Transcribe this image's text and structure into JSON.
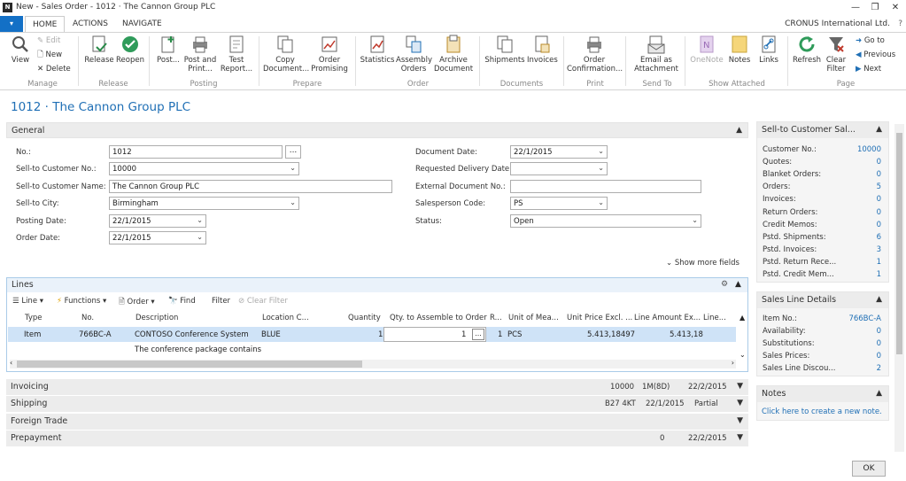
{
  "window": {
    "title": "New - Sales Order - 1012 · The Cannon Group PLC",
    "logo": "N",
    "company": "CRONUS International Ltd.",
    "help": "?"
  },
  "tabs": {
    "menu": "▾",
    "home": "HOME",
    "actions": "ACTIONS",
    "navigate": "NAVIGATE"
  },
  "ribbon": {
    "view": "View",
    "edit": "Edit",
    "new": "New",
    "delete": "Delete",
    "release": "Release",
    "reopen": "Reopen",
    "post": "Post...",
    "post_print_1": "Post and",
    "post_print_2": "Print...",
    "test_1": "Test",
    "test_2": "Report...",
    "copy_1": "Copy",
    "copy_2": "Document...",
    "promising_1": "Order",
    "promising_2": "Promising",
    "statistics": "Statistics",
    "assembly_1": "Assembly",
    "assembly_2": "Orders",
    "archive_1": "Archive",
    "archive_2": "Document",
    "shipments": "Shipments",
    "invoices": "Invoices",
    "order_conf_1": "Order",
    "order_conf_2": "Confirmation...",
    "email_1": "Email as",
    "email_2": "Attachment",
    "onenote": "OneNote",
    "notes": "Notes",
    "links": "Links",
    "refresh": "Refresh",
    "clear_1": "Clear",
    "clear_2": "Filter",
    "goto": "Go to",
    "previous": "Previous",
    "next": "Next",
    "groups": {
      "manage": "Manage",
      "release": "Release",
      "posting": "Posting",
      "prepare": "Prepare",
      "order": "Order",
      "documents": "Documents",
      "print": "Print",
      "send_to": "Send To",
      "show_attached": "Show Attached",
      "page": "Page"
    }
  },
  "page_title": "1012 · The Cannon Group PLC",
  "general": {
    "title": "General",
    "no_label": "No.:",
    "no_value": "1012",
    "cust_no_label": "Sell-to Customer No.:",
    "cust_no_value": "10000",
    "cust_name_label": "Sell-to Customer Name:",
    "cust_name_value": "The Cannon Group PLC",
    "city_label": "Sell-to City:",
    "city_value": "Birmingham",
    "posting_label": "Posting Date:",
    "posting_value": "22/1/2015",
    "order_label": "Order Date:",
    "order_value": "22/1/2015",
    "doc_date_label": "Document Date:",
    "doc_date_value": "22/1/2015",
    "req_del_label": "Requested Delivery Date:",
    "req_del_value": "",
    "ext_doc_label": "External Document No.:",
    "ext_doc_value": "",
    "salesperson_label": "Salesperson Code:",
    "salesperson_value": "PS",
    "status_label": "Status:",
    "status_value": "Open",
    "show_more": "Show more fields",
    "ellipsis": "..."
  },
  "lines": {
    "title": "Lines",
    "toolbar": {
      "line": "Line",
      "functions": "Functions",
      "order": "Order",
      "find": "Find",
      "filter": "Filter",
      "clear_filter": "Clear Filter"
    },
    "headers": [
      "Type",
      "No.",
      "Description",
      "Location C...",
      "Quantity",
      "Qty. to Assemble to Order",
      "R...",
      "Unit of Mea...",
      "Unit Price Excl. ...",
      "Line Amount Ex...",
      "Line..."
    ],
    "row": {
      "type": "Item",
      "no": "766BC-A",
      "description": "CONTOSO Conference System",
      "location": "BLUE",
      "quantity": "1",
      "qty_assemble": "1",
      "reserved": "1",
      "uom": "PCS",
      "unit_price": "5.413,18497",
      "line_amount": "5.413,18"
    },
    "note_row": "The conference package contains"
  },
  "invoicing": {
    "title": "Invoicing",
    "v1": "10000",
    "v2": "1M(8D)",
    "v3": "22/2/2015"
  },
  "shipping": {
    "title": "Shipping",
    "v1": "B27 4KT",
    "v2": "22/1/2015",
    "v3": "Partial"
  },
  "foreign_trade": {
    "title": "Foreign Trade"
  },
  "prepayment": {
    "title": "Prepayment",
    "v1": "0",
    "v2": "22/2/2015"
  },
  "factbox_customer": {
    "title": "Sell-to Customer Sal...",
    "items": [
      {
        "label": "Customer No.:",
        "value": "10000"
      },
      {
        "label": "Quotes:",
        "value": "0"
      },
      {
        "label": "Blanket Orders:",
        "value": "0"
      },
      {
        "label": "Orders:",
        "value": "5"
      },
      {
        "label": "Invoices:",
        "value": "0"
      },
      {
        "label": "Return Orders:",
        "value": "0"
      },
      {
        "label": "Credit Memos:",
        "value": "0"
      },
      {
        "label": "Pstd. Shipments:",
        "value": "6"
      },
      {
        "label": "Pstd. Invoices:",
        "value": "3"
      },
      {
        "label": "Pstd. Return Rece...",
        "value": "1"
      },
      {
        "label": "Pstd. Credit Mem...",
        "value": "1"
      }
    ]
  },
  "factbox_line": {
    "title": "Sales Line Details",
    "items": [
      {
        "label": "Item No.:",
        "value": "766BC-A"
      },
      {
        "label": "Availability:",
        "value": "0"
      },
      {
        "label": "Substitutions:",
        "value": "0"
      },
      {
        "label": "Sales Prices:",
        "value": "0"
      },
      {
        "label": "Sales Line Discou...",
        "value": "2"
      }
    ]
  },
  "notes": {
    "title": "Notes",
    "link": "Click here to create a new note."
  },
  "ok": "OK"
}
